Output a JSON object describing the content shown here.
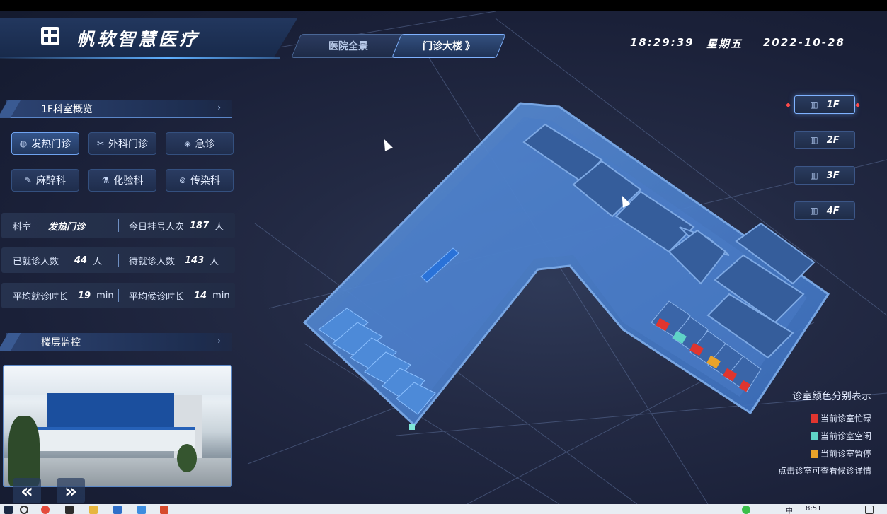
{
  "app": {
    "title": "帆软智慧医疗",
    "nav_tabs": [
      {
        "label": "医院全景",
        "active": false
      },
      {
        "label": "门诊大楼",
        "suffix": "》",
        "active": true
      }
    ],
    "time": "18:29:39",
    "weekday": "星期五",
    "date": "2022-10-28"
  },
  "overview": {
    "title": "1F科室概览",
    "more": "›",
    "departments": [
      {
        "label": "发热门诊",
        "icon": "globe-icon",
        "glyph": "◍",
        "active": true
      },
      {
        "label": "外科门诊",
        "icon": "scissors-icon",
        "glyph": "✂",
        "active": false
      },
      {
        "label": "急诊",
        "icon": "diamond-icon",
        "glyph": "◈",
        "active": false
      },
      {
        "label": "麻醉科",
        "icon": "syringe-icon",
        "glyph": "✎",
        "active": false
      },
      {
        "label": "化验科",
        "icon": "flask-icon",
        "glyph": "⚗",
        "active": false
      },
      {
        "label": "传染科",
        "icon": "virus-icon",
        "glyph": "⊚",
        "active": false
      }
    ],
    "stats": {
      "dept_label": "科室",
      "dept_value": "发热门诊",
      "registered_label": "今日挂号人次",
      "registered_value": "187",
      "registered_unit": "人",
      "seen_label": "已就诊人数",
      "seen_value": "44",
      "seen_unit": "人",
      "waiting_label": "待就诊人数",
      "waiting_value": "143",
      "waiting_unit": "人",
      "avg_visit_label": "平均就诊时长",
      "avg_visit_value": "19",
      "avg_visit_unit": "min",
      "avg_wait_label": "平均候诊时长",
      "avg_wait_value": "14",
      "avg_wait_unit": "min"
    }
  },
  "monitor": {
    "title": "楼层监控",
    "more": "›",
    "prev": "«",
    "next": "»"
  },
  "floors": [
    {
      "label": "1F",
      "active": true
    },
    {
      "label": "2F",
      "active": false
    },
    {
      "label": "3F",
      "active": false
    },
    {
      "label": "4F",
      "active": false
    }
  ],
  "legend": {
    "title": "诊室颜色分别表示",
    "items": [
      {
        "label": "当前诊室忙碌",
        "color": "#e0352f"
      },
      {
        "label": "当前诊室空闲",
        "color": "#5fd3c7"
      },
      {
        "label": "当前诊室暂停",
        "color": "#e9a32a"
      }
    ],
    "footer": "点击诊室可查看候诊详情"
  },
  "taskbar": {
    "clock": "8:51"
  }
}
